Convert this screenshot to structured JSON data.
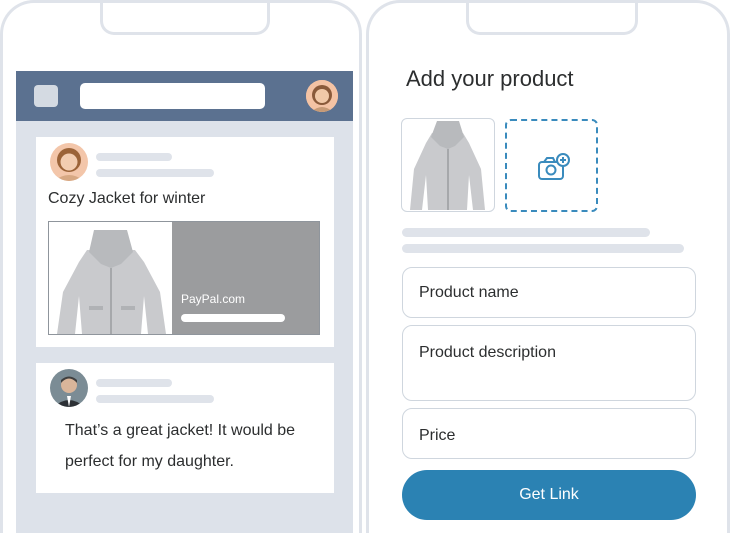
{
  "feed": {
    "post1": {
      "caption": "Cozy Jacket for winter",
      "link_domain": "PayPal.com"
    },
    "post2": {
      "comment_line1": "That’s a great jacket! It would be",
      "comment_line2": "perfect for my daughter."
    }
  },
  "form": {
    "title": "Add your product",
    "product_name_placeholder": "Product name",
    "product_description_placeholder": "Product description",
    "price_placeholder": "Price",
    "submit_label": "Get Link"
  },
  "colors": {
    "header_blue": "#5b7190",
    "primary_button": "#2b82b3",
    "dashed_accent": "#3a8bbd",
    "frame_gray": "#dfe3ea"
  },
  "icons": [
    "camera-plus-icon"
  ]
}
